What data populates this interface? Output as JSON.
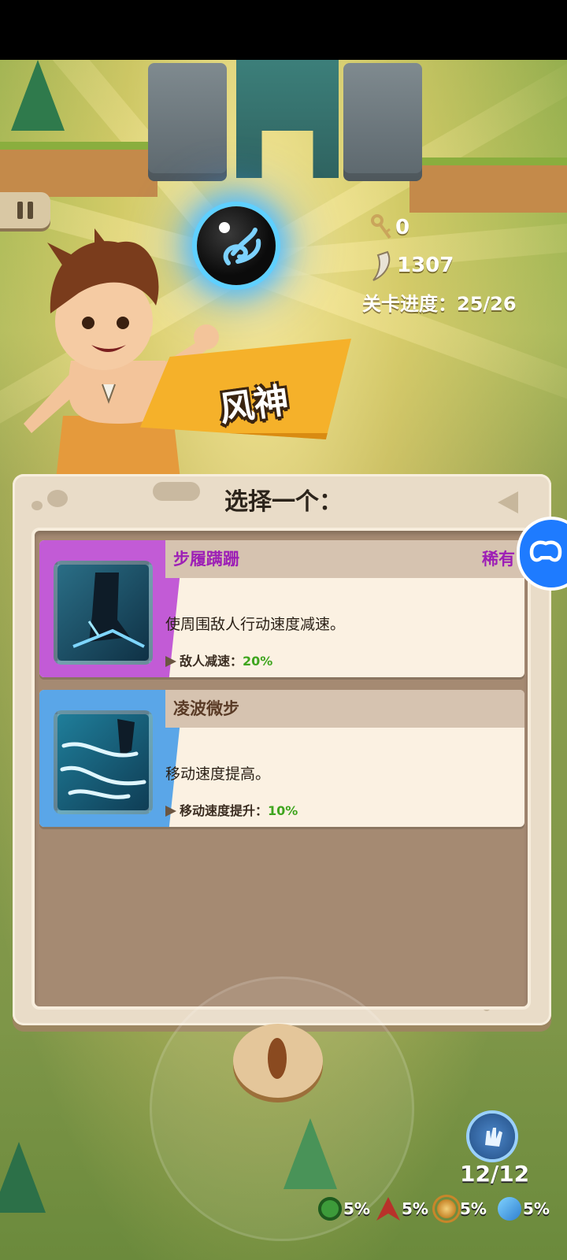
{
  "hud": {
    "key_count": "0",
    "claw_count": "1307",
    "level_progress": "关卡进度：25/26"
  },
  "skill_banner": {
    "name": "风神"
  },
  "panel": {
    "title": "选择一个：",
    "cards": [
      {
        "title": "步履蹒跚",
        "rarity": "稀有",
        "description": "使周围敌人行动速度减速。",
        "stat_label": "敌人减速：",
        "stat_value": "20%",
        "side_color": "#c25bd6",
        "title_color": "#9d1fb6",
        "icon": "boot-slow-icon"
      },
      {
        "title": "凌波微步",
        "description": "移动速度提高。",
        "stat_label": "移动速度提升：",
        "stat_value": "10%",
        "side_color": "#5aa6e8",
        "title_color": "#5a3b26",
        "icon": "wind-step-icon"
      }
    ]
  },
  "bottom": {
    "skill_counter": "12/12",
    "buffs": [
      {
        "icon": "green-swirl-icon",
        "value": "5%",
        "color": "#3d9b3a"
      },
      {
        "icon": "red-claw-icon",
        "value": "5%",
        "color": "#b8312a"
      },
      {
        "icon": "sun-ring-icon",
        "value": "5%",
        "color": "#c8862a"
      },
      {
        "icon": "blue-wind-icon",
        "value": "5%",
        "color": "#2f7fd0"
      }
    ]
  }
}
